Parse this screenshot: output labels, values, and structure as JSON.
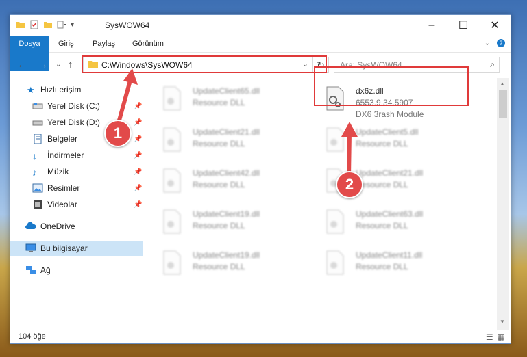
{
  "window": {
    "title": "SysWOW64"
  },
  "ribbon": {
    "tabs": [
      "Dosya",
      "Giriş",
      "Paylaş",
      "Görünüm"
    ]
  },
  "address": {
    "path": "C:\\Windows\\SysWOW64"
  },
  "search": {
    "placeholder": "Ara: SysWOW64"
  },
  "sidebar": {
    "items": [
      {
        "label": "Hızlı erişim",
        "icon": "star-icon"
      },
      {
        "label": "Yerel Disk (C:)",
        "icon": "drive-icon",
        "pinned": true
      },
      {
        "label": "Yerel Disk (D:)",
        "icon": "drive-icon",
        "pinned": true
      },
      {
        "label": "Belgeler",
        "icon": "documents-icon",
        "pinned": true
      },
      {
        "label": "İndirmeler",
        "icon": "download-icon",
        "pinned": true
      },
      {
        "label": "Müzik",
        "icon": "music-icon",
        "pinned": true
      },
      {
        "label": "Resimler",
        "icon": "pictures-icon",
        "pinned": true
      },
      {
        "label": "Videolar",
        "icon": "video-icon",
        "pinned": true
      },
      {
        "label": "OneDrive",
        "icon": "cloud-icon"
      },
      {
        "label": "Bu bilgisayar",
        "icon": "computer-icon",
        "selected": true
      },
      {
        "label": "Ağ",
        "icon": "network-icon"
      }
    ]
  },
  "files": [
    {
      "name": "UpdateClient65.dll",
      "type": "Resource DLL"
    },
    {
      "name": "dx6z.dll",
      "version": "6553.9.34.5907",
      "description": "DX6 3rash Module",
      "selected": true
    },
    {
      "name": "UpdateClient21.dll",
      "type": "Resource DLL"
    },
    {
      "name": "UpdateClient5.dll",
      "type": "Resource DLL"
    },
    {
      "name": "UpdateClient42.dll",
      "type": "Resource DLL"
    },
    {
      "name": "UpdateClient21.dll",
      "type": "Resource DLL"
    },
    {
      "name": "UpdateClient19.dll",
      "type": "Resource DLL"
    },
    {
      "name": "UpdateClient63.dll",
      "type": "Resource DLL"
    },
    {
      "name": "UpdateClient19.dll",
      "type": "Resource DLL"
    },
    {
      "name": "UpdateClient11.dll",
      "type": "Resource DLL"
    }
  ],
  "status": {
    "count": "104 öğe"
  },
  "annotations": {
    "step1": "1",
    "step2": "2"
  },
  "colors": {
    "accent": "#1979ca",
    "highlight": "#e03a3a",
    "selected": "#cce4f7"
  }
}
